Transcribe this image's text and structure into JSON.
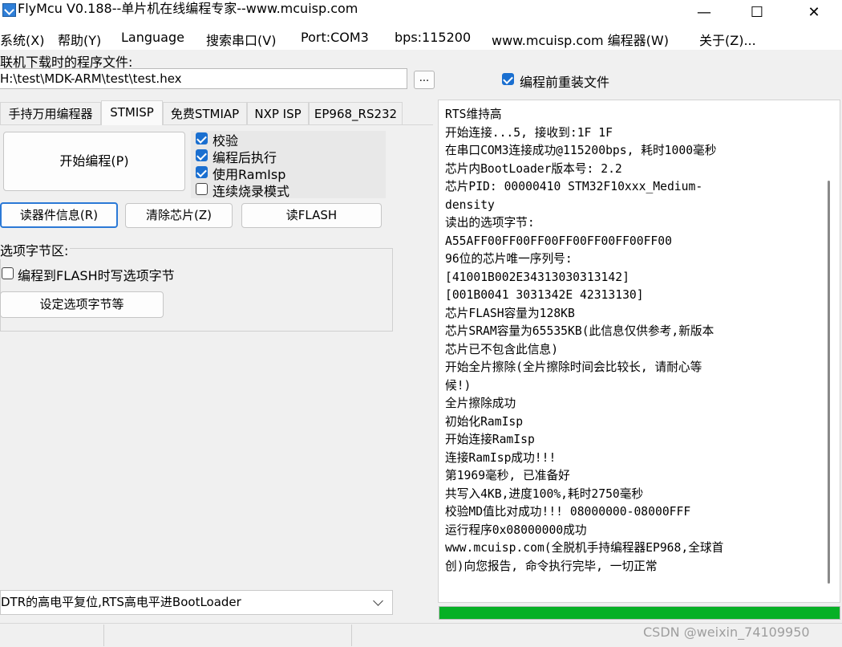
{
  "window": {
    "title": "FlyMcu V0.188--单片机在线编程专家--www.mcuisp.com",
    "minimize": "—",
    "maximize": "☐",
    "close": "✕"
  },
  "menu": [
    "系统(X)",
    "帮助(Y)",
    "Language",
    "搜索串口(V)",
    "Port:COM3",
    "bps:115200",
    "www.mcuisp.com 编程器(W)",
    "关于(Z)..."
  ],
  "file": {
    "label": "联机下载时的程序文件:",
    "path": "H:\\test\\MDK-ARM\\test\\test.hex",
    "browse_label": "...",
    "reload_label": "编程前重装文件",
    "reload_checked": true
  },
  "tabs": [
    "手持万用编程器",
    "STMISP",
    "免费STMIAP",
    "NXP ISP",
    "EP968_RS232"
  ],
  "active_tab": "STMISP",
  "stmisp": {
    "start_button": "开始编程(P)",
    "options": [
      {
        "label": "校验",
        "checked": true
      },
      {
        "label": "编程后执行",
        "checked": true
      },
      {
        "label": "使用RamIsp",
        "checked": true
      },
      {
        "label": "连续烧录模式",
        "checked": false
      }
    ],
    "read_info_button": "读器件信息(R)",
    "clear_chip_button": "清除芯片(Z)",
    "read_flash_button": "读FLASH",
    "option_group_title": "选项字节区:",
    "write_option_label": "编程到FLASH时写选项字节",
    "write_option_checked": false,
    "set_option_button": "设定选项字节等",
    "boot_mode": "DTR的高电平复位,RTS高电平进BootLoader"
  },
  "log": [
    "RTS维持高",
    "开始连接...5, 接收到:1F 1F",
    "在串口COM3连接成功@115200bps, 耗时1000毫秒",
    "芯片内BootLoader版本号: 2.2",
    "芯片PID: 00000410  STM32F10xxx_Medium-",
    "density",
    "读出的选项字节:",
    "A55AFF00FF00FF00FF00FF00FF00FF00",
    "96位的芯片唯一序列号:",
    "[41001B002E34313030313142]",
    "[001B0041 3031342E 42313130]",
    "芯片FLASH容量为128KB",
    "芯片SRAM容量为65535KB(此信息仅供参考,新版本",
    "芯片已不包含此信息)",
    "开始全片擦除(全片擦除时间会比较长, 请耐心等",
    "候!)",
    "全片擦除成功",
    "初始化RamIsp",
    "开始连接RamIsp",
    "连接RamIsp成功!!!",
    "第1969毫秒, 已准备好",
    "共写入4KB,进度100%,耗时2750毫秒",
    "校验MD值比对成功!!! 08000000-08000FFF",
    "运行程序0x08000000成功",
    "www.mcuisp.com(全脱机手持编程器EP968,全球首",
    "创)向您报告, 命令执行完毕, 一切正常"
  ],
  "progress_fraction": 1.0,
  "colors": {
    "progress": "#06b025",
    "checkbox": "#1a6fd0"
  },
  "watermark": "CSDN @weixin_74109950"
}
